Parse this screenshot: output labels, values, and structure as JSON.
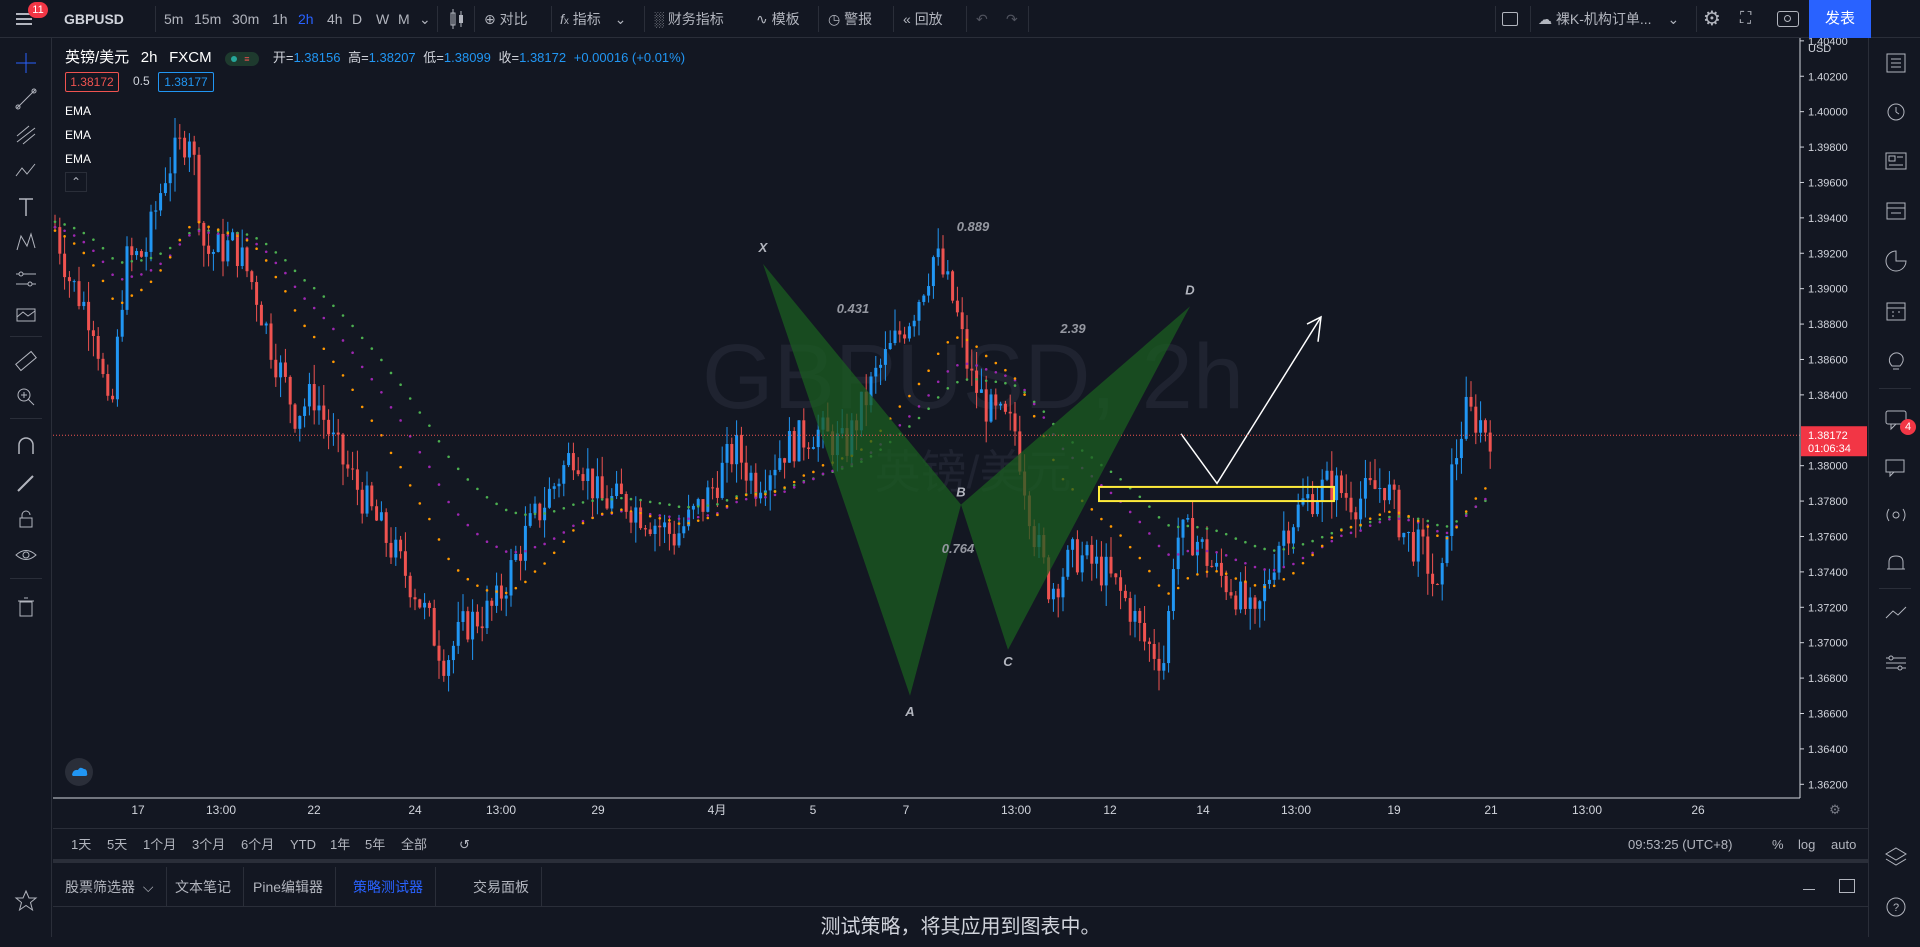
{
  "topbar": {
    "notifications": "11",
    "symbol": "GBPUSD",
    "intervals": [
      "5m",
      "15m",
      "30m",
      "1h",
      "2h",
      "4h",
      "D",
      "W",
      "M"
    ],
    "active_interval": "2h",
    "compare": "对比",
    "indicators": "指标",
    "financials": "财务指标",
    "templates": "模板",
    "alerts": "警报",
    "replay": "回放",
    "layout_name": "裸K-机构订单...",
    "publish": "发表"
  },
  "legend": {
    "title": "英镑/美元",
    "interval": "2h",
    "exchange": "FXCM",
    "open_label": "开=",
    "open": "1.38156",
    "high_label": "高=",
    "high": "1.38207",
    "low_label": "低=",
    "low": "1.38099",
    "close_label": "收=",
    "close": "1.38172",
    "change": "+0.00016 (+0.01%)",
    "sell_price": "1.38172",
    "spread": "0.5",
    "buy_price": "1.38177",
    "ema_labels": [
      "EMA",
      "EMA",
      "EMA"
    ]
  },
  "watermark": {
    "line1": "GBPUSD, 2h",
    "line2": "英镑/美元"
  },
  "price_axis": {
    "currency": "USD",
    "ticks": [
      "1.40400",
      "1.40200",
      "1.40000",
      "1.39800",
      "1.39600",
      "1.39400",
      "1.39200",
      "1.39000",
      "1.38800",
      "1.38600",
      "1.38400",
      "1.38000",
      "1.37800",
      "1.37600",
      "1.37400",
      "1.37200",
      "1.37000",
      "1.36800",
      "1.36600",
      "1.36400",
      "1.36200"
    ],
    "current_price": "1.38172",
    "countdown": "01:06:34"
  },
  "time_axis": {
    "ticks": [
      "17",
      "13:00",
      "22",
      "24",
      "13:00",
      "29",
      "4月",
      "5",
      "7",
      "13:00",
      "12",
      "14",
      "13:00",
      "19",
      "21",
      "13:00",
      "26"
    ]
  },
  "pattern": {
    "points": [
      "X",
      "A",
      "B",
      "C",
      "D"
    ],
    "ratios": [
      "0.889",
      "0.431",
      "2.39",
      "0.764"
    ]
  },
  "chart_data": {
    "type": "candlestick",
    "symbol": "GBPUSD",
    "timeframe": "2h",
    "ylim": [
      1.361,
      1.4045
    ],
    "last_close": 1.38172,
    "harmonic_pattern": {
      "X": 1.3914,
      "A": 1.367,
      "B": 1.3778,
      "C": 1.3696,
      "D": 1.389,
      "ratios": {
        "XB": 0.431,
        "XD": 0.889,
        "BD": 2.39,
        "AC": 0.764
      }
    },
    "zone": {
      "low": 1.378,
      "high": 1.3788
    },
    "ema_series_colors": [
      "#4caf50",
      "#9c27b0",
      "#ff9800"
    ]
  },
  "bottom": {
    "ranges": [
      "1天",
      "5天",
      "1个月",
      "3个月",
      "6个月",
      "YTD",
      "1年",
      "5年",
      "全部"
    ],
    "clock": "09:53:25 (UTC+8)",
    "percent": "%",
    "log": "log",
    "auto": "auto"
  },
  "tabs": [
    "股票筛选器",
    "文本笔记",
    "Pine编辑器",
    "策略测试器",
    "交易面板"
  ],
  "active_tab": "策略测试器",
  "panel_message": "测试策略，将其应用到图表中。",
  "right_badge": "4",
  "colors": {
    "up": "#2196f3",
    "down": "#ef5350",
    "accent": "#2962ff",
    "pattern": "#1b5e20"
  }
}
